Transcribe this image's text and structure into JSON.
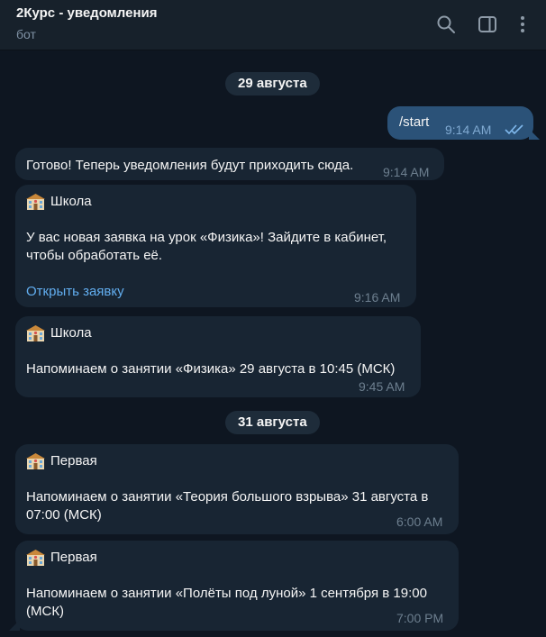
{
  "header": {
    "title": "2Курс - уведомления",
    "subtitle": "бот",
    "icons": [
      "search-icon",
      "sidebar-toggle-icon",
      "more-vertical-icon"
    ]
  },
  "dates": [
    "29 августа",
    "31 августа"
  ],
  "messages": [
    {
      "direction": "out",
      "text": "/start",
      "time": "9:14 AM",
      "status": "read"
    },
    {
      "direction": "in",
      "text": "Готово! Теперь уведомления будут приходить сюда.",
      "time": "9:14 AM"
    },
    {
      "direction": "in",
      "sender": "Школа",
      "icon": "school-building-icon",
      "lines": [
        "У вас новая заявка на урок «Физика»! Зайдите в кабинет,",
        "чтобы обработать её."
      ],
      "link": "Открыть заявку",
      "time": "9:16 AM"
    },
    {
      "direction": "in",
      "sender": "Школа",
      "icon": "school-building-icon",
      "lines": [
        "Напоминаем о занятии «Физика» 29 августа в 10:45 (МСК)"
      ],
      "time": "9:45 AM"
    },
    {
      "direction": "in",
      "sender": "Первая",
      "icon": "school-building-icon",
      "lines": [
        "Напоминаем о занятии «Теория большого взрыва» 31 августа в",
        "07:00 (МСК)"
      ],
      "time": "6:00 AM"
    },
    {
      "direction": "in",
      "sender": "Первая",
      "icon": "school-building-icon",
      "lines": [
        "Напоминаем о занятии «Полёты под луной» 1 сентября в 19:00",
        "(МСК)"
      ],
      "time": "7:00 PM"
    }
  ],
  "colors": {
    "background": "#0e1621",
    "header": "#17212b",
    "incoming_bubble": "#182533",
    "outgoing_bubble": "#2b5278",
    "link": "#62aef0",
    "read_checks": "#7fb8ec"
  }
}
